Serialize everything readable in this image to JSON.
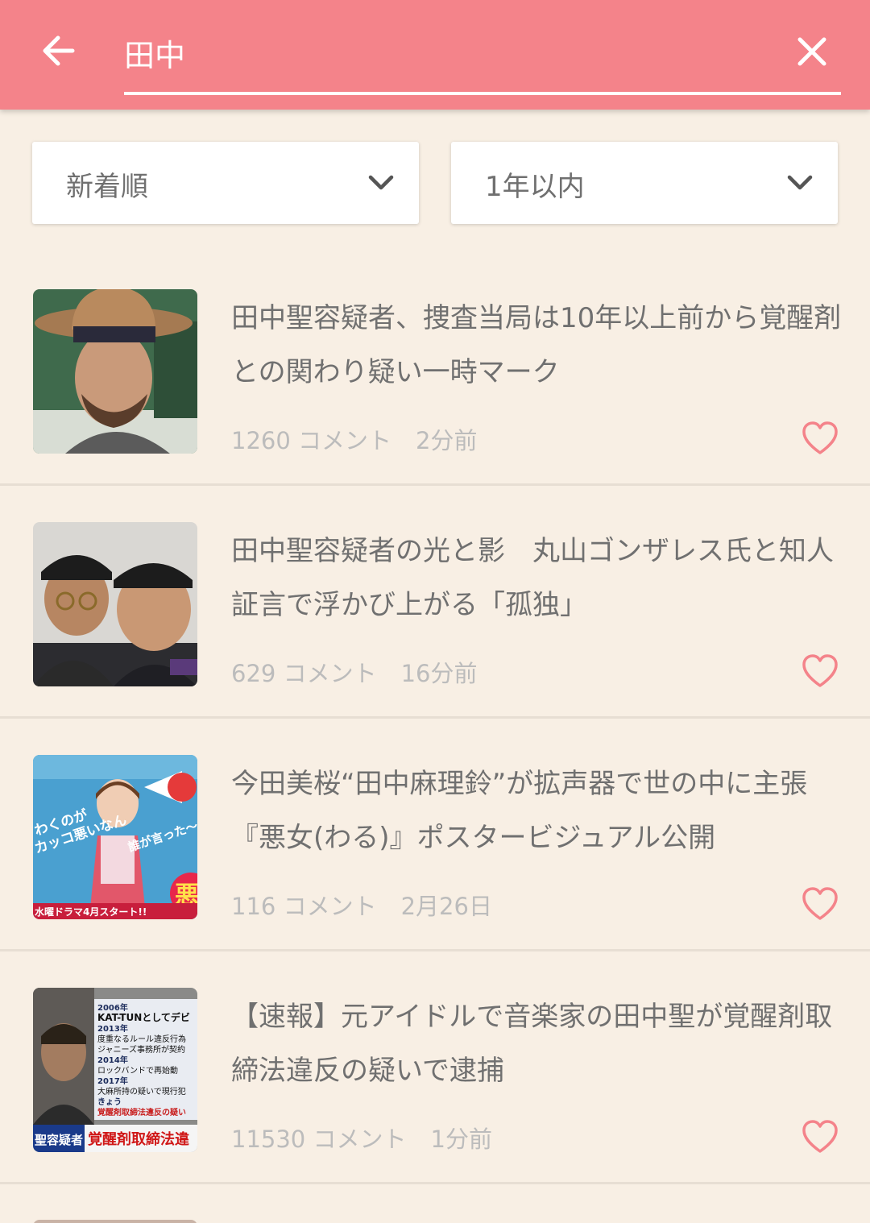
{
  "header": {
    "search_value": "田中",
    "back_icon": "arrow-left-icon",
    "clear_icon": "close-icon",
    "background_color": "#f4838a"
  },
  "filters": {
    "sort": {
      "selected": "新着順"
    },
    "period": {
      "selected": "1年以内"
    }
  },
  "articles": [
    {
      "title": "田中聖容疑者、捜査当局は10年以上前から覚醒剤との関わり疑い一時マーク",
      "comment_count": "1260",
      "comment_label": "コメント",
      "time": "2分前"
    },
    {
      "title": "田中聖容疑者の光と影　丸山ゴンザレス氏と知人証言で浮かび上がる「孤独」",
      "comment_count": "629",
      "comment_label": "コメント",
      "time": "16分前"
    },
    {
      "title": "今田美桜“田中麻理鈴”が拡声器で世の中に主張『悪女(わる)』ポスタービジュアル公開",
      "comment_count": "116",
      "comment_label": "コメント",
      "time": "2月26日",
      "thumb_text": {
        "line1": "わくのが",
        "line2": "カッコ悪いなん",
        "line3": "誰が言った〜",
        "badge": "悪",
        "banner": "水曜ドラマ4月スタート!!"
      }
    },
    {
      "title": "【速報】元アイドルで音楽家の田中聖が覚醒剤取締法違反の疑いで逮捕",
      "comment_count": "11530",
      "comment_label": "コメント",
      "time": "1分前",
      "thumb_text": {
        "years": [
          "2006年",
          "KAT-TUNとしてデビ",
          "2013年",
          "度重なるルール違反行為",
          "ジャニーズ事務所が契約",
          "2014年",
          "ロックバンドで再始動",
          "2017年",
          "大麻所持の疑いで現行犯",
          "きょう",
          "覚醒剤取締法違反の疑い"
        ],
        "caption_name": "聖容疑者",
        "caption_text": "覚醒剤取締法違"
      }
    }
  ],
  "colors": {
    "background": "#f8efe4",
    "heart": "#f4838a",
    "title_text": "#707070",
    "meta_text": "#bcbcbc"
  }
}
